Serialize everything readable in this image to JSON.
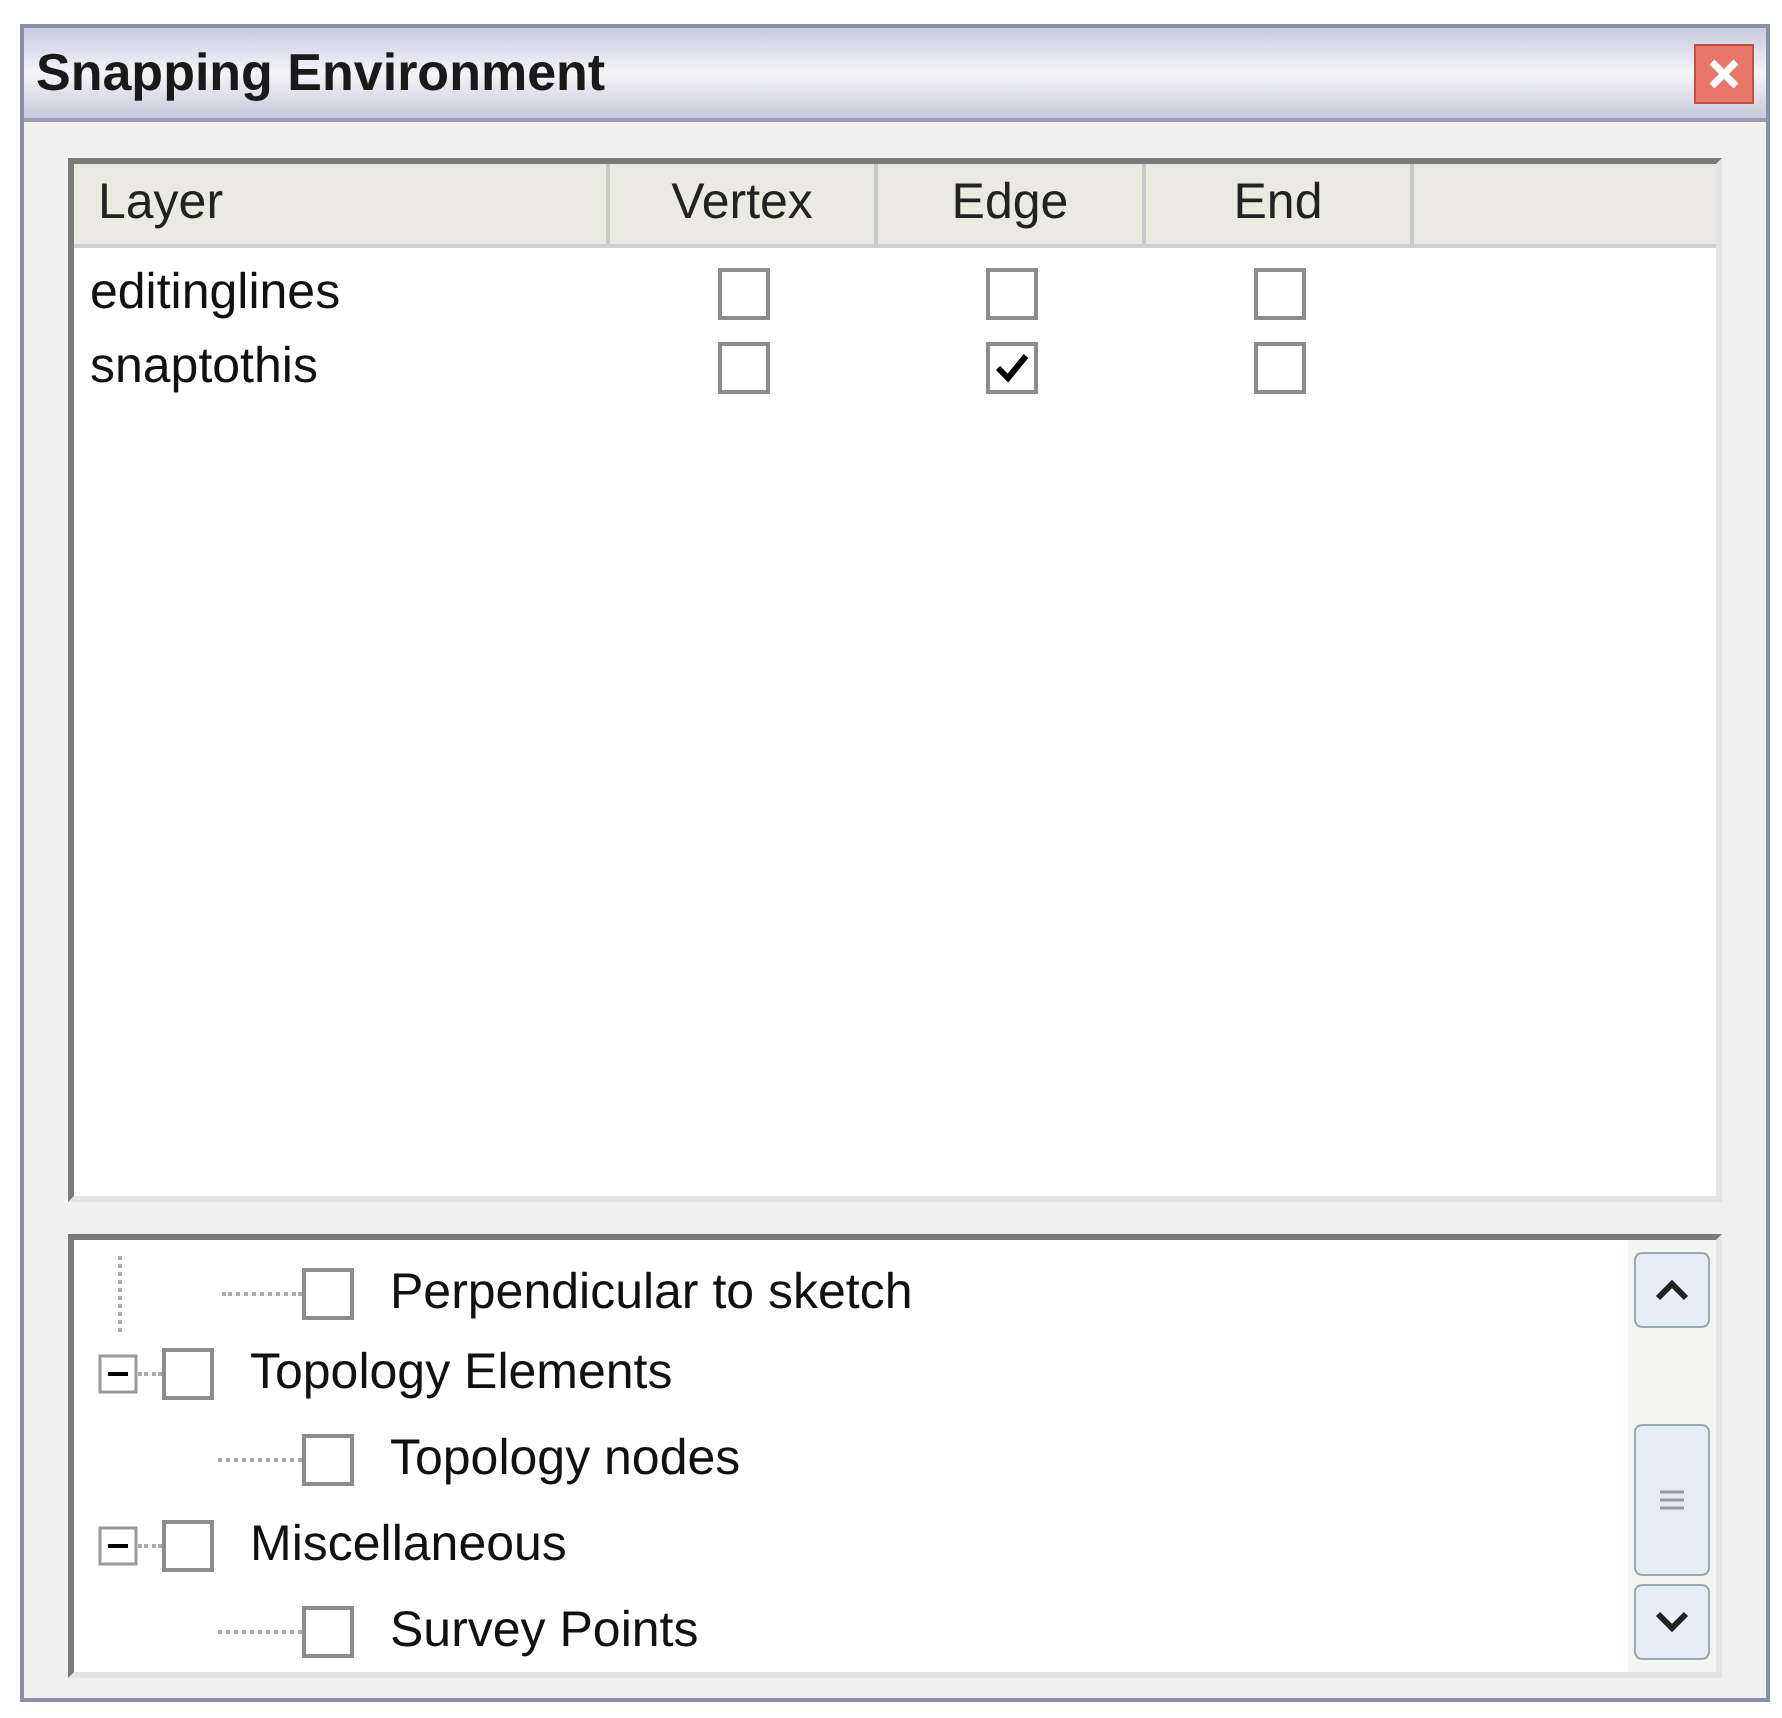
{
  "window": {
    "title": "Snapping Environment"
  },
  "table": {
    "columns": [
      "Layer",
      "Vertex",
      "Edge",
      "End"
    ],
    "rows": [
      {
        "layer": "editinglines",
        "vertex": false,
        "edge": false,
        "end": false
      },
      {
        "layer": "snaptothis",
        "vertex": false,
        "edge": true,
        "end": false
      }
    ]
  },
  "tree": {
    "continued_children": [
      {
        "label": "Perpendicular to sketch",
        "checked": false
      }
    ],
    "items": [
      {
        "label": "Topology Elements",
        "checked": false,
        "expanded": true,
        "children": [
          {
            "label": "Topology nodes",
            "checked": false
          }
        ]
      },
      {
        "label": "Miscellaneous",
        "checked": false,
        "expanded": true,
        "children": [
          {
            "label": "Survey Points",
            "checked": false
          }
        ]
      }
    ]
  }
}
